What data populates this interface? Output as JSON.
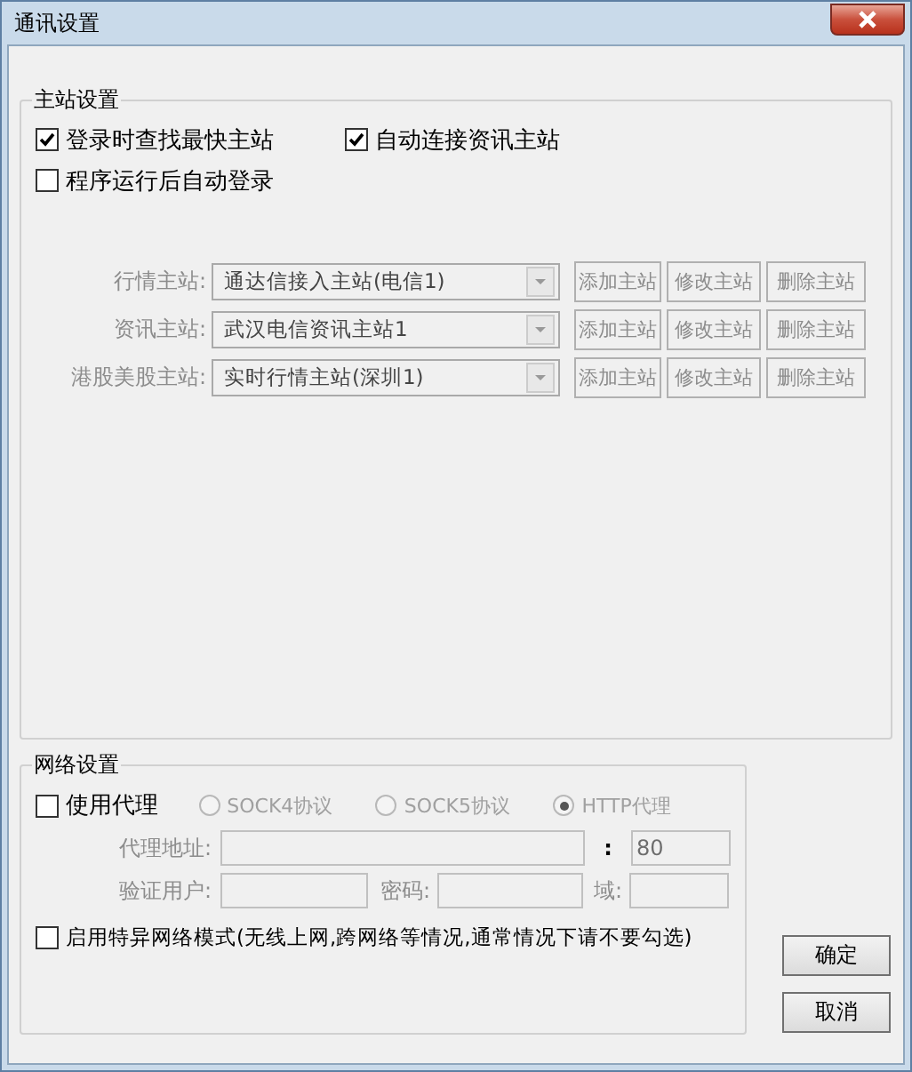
{
  "window": {
    "title": "通讯设置"
  },
  "server_settings": {
    "title": "主站设置",
    "options": [
      {
        "label": "登录时查找最快主站",
        "checked": true
      },
      {
        "label": "自动连接资讯主站",
        "checked": true
      },
      {
        "label": "程序运行后自动登录",
        "checked": false
      }
    ],
    "servers": [
      {
        "label": "行情主站:",
        "value": "通达信接入主站(电信1)",
        "disabled": true,
        "buttons": [
          {
            "label": "添加主站",
            "disabled": true
          },
          {
            "label": "修改主站",
            "disabled": true
          },
          {
            "label": "删除主站",
            "disabled": true
          }
        ]
      },
      {
        "label": "资讯主站:",
        "value": "武汉电信资讯主站1",
        "disabled": true,
        "buttons": [
          {
            "label": "添加主站",
            "disabled": true
          },
          {
            "label": "修改主站",
            "disabled": true
          },
          {
            "label": "删除主站",
            "disabled": true
          }
        ]
      },
      {
        "label": "港股美股主站:",
        "value": "实时行情主站(深圳1)",
        "disabled": true,
        "buttons": [
          {
            "label": "添加主站",
            "disabled": true
          },
          {
            "label": "修改主站",
            "disabled": true
          },
          {
            "label": "删除主站",
            "disabled": true
          }
        ]
      }
    ]
  },
  "network_settings": {
    "title": "网络设置",
    "use_proxy": {
      "label": "使用代理",
      "checked": false
    },
    "protocols": [
      {
        "label": "SOCK4协议",
        "selected": false,
        "disabled": true
      },
      {
        "label": "SOCK5协议",
        "selected": false,
        "disabled": true
      },
      {
        "label": "HTTP代理",
        "selected": true,
        "disabled": true
      }
    ],
    "proxy_address": {
      "label": "代理地址:",
      "separator": ":",
      "port": "80",
      "disabled": true
    },
    "auth": {
      "user_label": "验证用户:",
      "password_label": "密码:",
      "domain_label": "域:",
      "disabled": true
    },
    "special_mode": {
      "label": "启用特异网络模式(无线上网,跨网络等情况,通常情况下请不要勾选)",
      "checked": false
    }
  },
  "buttons": [
    "确定",
    "取消"
  ]
}
